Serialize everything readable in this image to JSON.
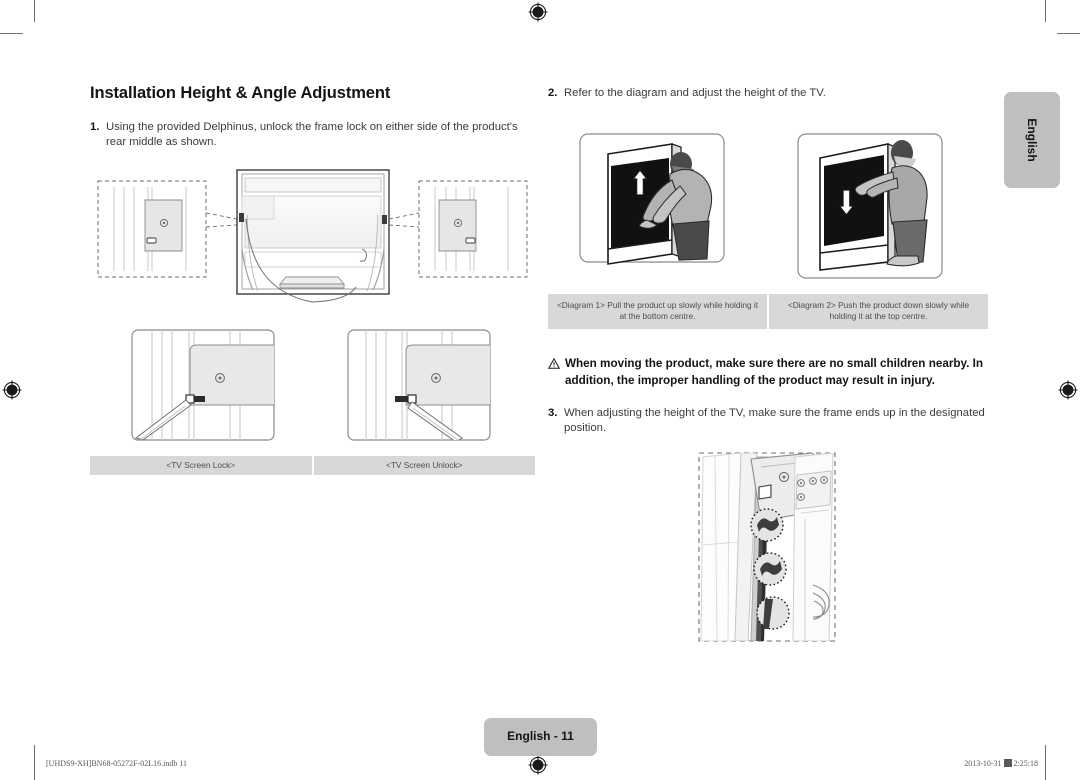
{
  "document": {
    "title": "Installation Height & Angle Adjustment",
    "language_tab": "English",
    "page_badge": "English - 11",
    "footer_file": "[UHDS9-XH]BN68-05272F-02L16.indb   11",
    "footer_date": "2013-10-31",
    "footer_time": "2:25:18"
  },
  "left_column": {
    "steps": [
      {
        "number": "1.",
        "text": "Using the provided Delphinus, unlock the frame lock on either side of the product's rear middle as shown."
      }
    ],
    "figure_captions": [
      "<TV Screen Lock>",
      "<TV Screen Unlock>"
    ]
  },
  "right_column": {
    "steps": [
      {
        "number": "2.",
        "text": "Refer to the diagram and adjust the height of the TV."
      },
      {
        "number": "3.",
        "text": "When adjusting the height of the TV, make sure the frame ends up in the designated position."
      }
    ],
    "diagram_captions": [
      "<Diagram 1> Pull the product up slowly while holding it at the bottom centre.",
      "<Diagram 2> Push the product down slowly while holding it at the top centre."
    ],
    "warning": {
      "icon": "warning-triangle",
      "text": "When moving the product, make sure there are no small children nearby. In addition, the improper handling of the product may result in injury."
    }
  },
  "colors": {
    "badge_grey": "#bfbfbf",
    "caption_grey": "#d8d8d8",
    "body_text": "#3b3b3b",
    "heading_text": "#141414"
  }
}
